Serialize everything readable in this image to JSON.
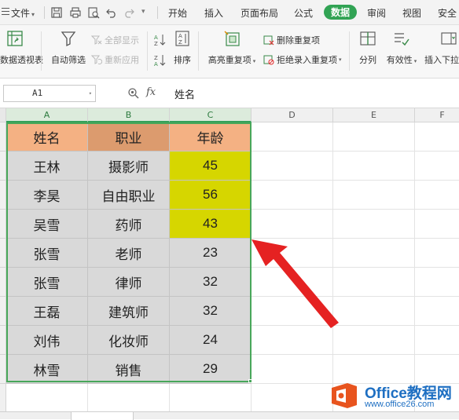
{
  "menubar": {
    "file_label": "文件",
    "tabs": [
      {
        "label": "开始",
        "active": false
      },
      {
        "label": "插入",
        "active": false
      },
      {
        "label": "页面布局",
        "active": false
      },
      {
        "label": "公式",
        "active": false
      },
      {
        "label": "数据",
        "active": true
      },
      {
        "label": "审阅",
        "active": false
      },
      {
        "label": "视图",
        "active": false
      },
      {
        "label": "安全",
        "active": false
      }
    ],
    "quick_access_icons": [
      "save-icon",
      "print-icon",
      "print-preview-icon",
      "undo-icon",
      "redo-icon",
      "dropdown-icon"
    ]
  },
  "ribbon": {
    "pivot_label": "数据透视表",
    "autofilter_label": "自动筛选",
    "show_all_label": "全部显示",
    "reapply_label": "重新应用",
    "sort_label": "排序",
    "highlight_dup_label": "高亮重复项",
    "delete_dup_label": "删除重复项",
    "reject_dup_label": "拒绝录入重复项",
    "split_label": "分列",
    "validity_label": "有效性",
    "insert_dropdown_label": "插入下拉",
    "accent_color": "#31a354"
  },
  "formula_bar": {
    "name_box": "A1",
    "fx_label": "fx",
    "formula": "姓名"
  },
  "sheet": {
    "columns": [
      "A",
      "B",
      "C",
      "D",
      "E",
      "F"
    ],
    "header_fill": "#f4b183",
    "header_fill_alt": "#dc9b6e",
    "body_fill": "#d9d9d9",
    "highlight_fill": "#d6d600",
    "headers": [
      "姓名",
      "职业",
      "年龄"
    ],
    "rows": [
      {
        "name": "王林",
        "job": "摄影师",
        "age": "45",
        "highlight": true
      },
      {
        "name": "李昊",
        "job": "自由职业",
        "age": "56",
        "highlight": true
      },
      {
        "name": "吴雪",
        "job": "药师",
        "age": "43",
        "highlight": true
      },
      {
        "name": "张雪",
        "job": "老师",
        "age": "23",
        "highlight": false
      },
      {
        "name": "张雪",
        "job": "律师",
        "age": "32",
        "highlight": false
      },
      {
        "name": "王磊",
        "job": "建筑师",
        "age": "32",
        "highlight": false
      },
      {
        "name": "刘伟",
        "job": "化妆师",
        "age": "24",
        "highlight": false
      },
      {
        "name": "林雪",
        "job": "销售",
        "age": "29",
        "highlight": false
      }
    ]
  },
  "watermark": {
    "brand": "Office教程网",
    "url": "www.office26.com",
    "brand_color": "#1e6fc2",
    "logo_color": "#e8541e"
  },
  "annotation_arrow_color": "#e02020"
}
